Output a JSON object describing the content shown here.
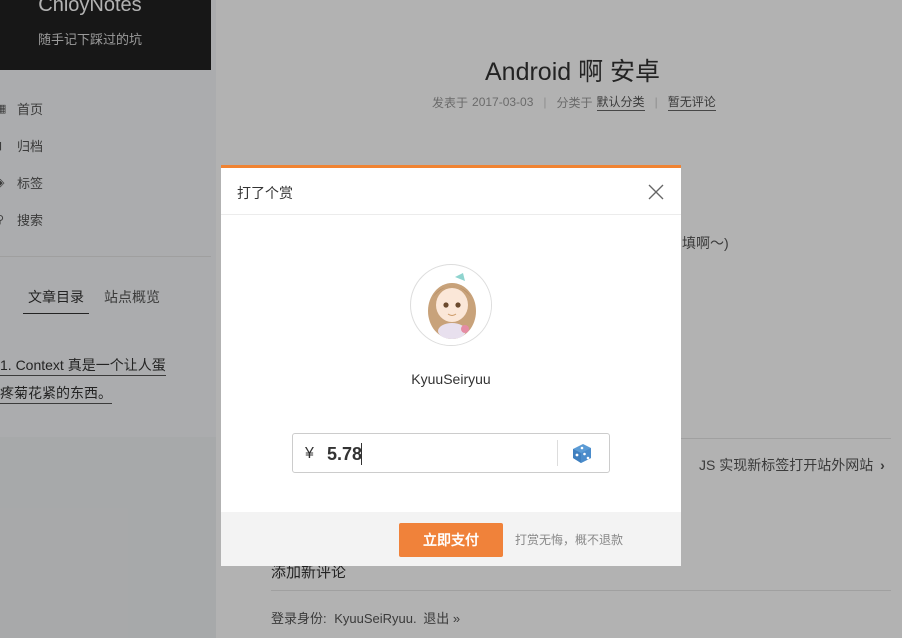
{
  "sidebar": {
    "brand_name": "ChioyNotes",
    "brand_subtitle": "随手记下踩过的坑",
    "menu": [
      {
        "label": "首页",
        "icon": "home-icon"
      },
      {
        "label": "归档",
        "icon": "archive-icon"
      },
      {
        "label": "标签",
        "icon": "tags-icon"
      },
      {
        "label": "搜索",
        "icon": "search-icon"
      }
    ],
    "tabs": [
      {
        "label": "文章目录",
        "active": true
      },
      {
        "label": "站点概览",
        "active": false
      }
    ],
    "toc": [
      {
        "line1": "1. Context 真是一个让人蛋",
        "line2": "疼菊花紧的东西。"
      }
    ]
  },
  "post": {
    "title": "Android 啊 安卓",
    "meta": {
      "posted_prefix": "发表于",
      "date": "2017-03-03",
      "category_prefix": "分类于",
      "category": "默认分类",
      "comments": "暂无评论"
    },
    "body_fragment": "填啊～)",
    "next_post": "JS 实现新标签打开站外网站",
    "comment_heading": "添加新评论",
    "login_prefix": "登录身份:",
    "login_user": "KyuuSeiRyuu.",
    "logout": "退出 »"
  },
  "reward_modal": {
    "title": "打了个赏",
    "username": "KyuuSeiryuu",
    "currency": "¥",
    "amount": "5.78",
    "pay_button": "立即支付",
    "note": "打赏无悔，概不退款"
  },
  "colors": {
    "accent": "#f08332",
    "brand_bg": "#222222"
  }
}
